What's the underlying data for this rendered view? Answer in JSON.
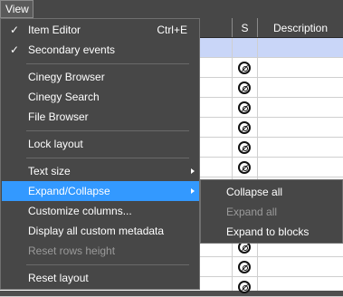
{
  "menubar": {
    "view_label": "View"
  },
  "grid": {
    "columns": {
      "s": "S",
      "description": "Description"
    },
    "rows": [
      {
        "selected": true,
        "s_icon": false
      },
      {
        "selected": false,
        "s_icon": true
      },
      {
        "selected": false,
        "s_icon": true
      },
      {
        "selected": false,
        "s_icon": true
      },
      {
        "selected": false,
        "s_icon": true
      },
      {
        "selected": false,
        "s_icon": true
      },
      {
        "selected": false,
        "s_icon": true
      },
      {
        "selected": false,
        "s_icon": true
      },
      {
        "selected": false,
        "s_icon": true
      },
      {
        "selected": false,
        "s_icon": true
      },
      {
        "selected": false,
        "s_icon": true
      },
      {
        "selected": false,
        "s_icon": true
      },
      {
        "selected": false,
        "s_icon": true
      }
    ]
  },
  "view_menu": {
    "item_editor": {
      "label": "Item Editor",
      "shortcut": "Ctrl+E",
      "checked": true
    },
    "secondary_events": {
      "label": "Secondary events",
      "checked": true
    },
    "cinegy_browser": {
      "label": "Cinegy Browser"
    },
    "cinegy_search": {
      "label": "Cinegy Search"
    },
    "file_browser": {
      "label": "File Browser"
    },
    "lock_layout": {
      "label": "Lock layout"
    },
    "text_size": {
      "label": "Text size",
      "has_submenu": true
    },
    "expand_collapse": {
      "label": "Expand/Collapse",
      "has_submenu": true,
      "highlighted": true
    },
    "customize_columns": {
      "label": "Customize columns..."
    },
    "display_all_custom_metadata": {
      "label": "Display all custom metadata"
    },
    "reset_rows_height": {
      "label": "Reset rows height",
      "disabled": true
    },
    "reset_layout": {
      "label": "Reset layout"
    },
    "check_glyph": "✓"
  },
  "expand_collapse_submenu": {
    "collapse_all": {
      "label": "Collapse all"
    },
    "expand_all": {
      "label": "Expand all",
      "disabled": true
    },
    "expand_to_blocks": {
      "label": "Expand to blocks"
    }
  },
  "colors": {
    "menu_bg": "#474747",
    "highlight": "#3399ff",
    "selected_row": "#c9d6f8",
    "disabled_text": "#9a9a9a"
  },
  "icons": {
    "s_column_icon": "secondary-event-icon",
    "submenu_arrow": "chevron-right-icon",
    "check": "check-icon"
  }
}
